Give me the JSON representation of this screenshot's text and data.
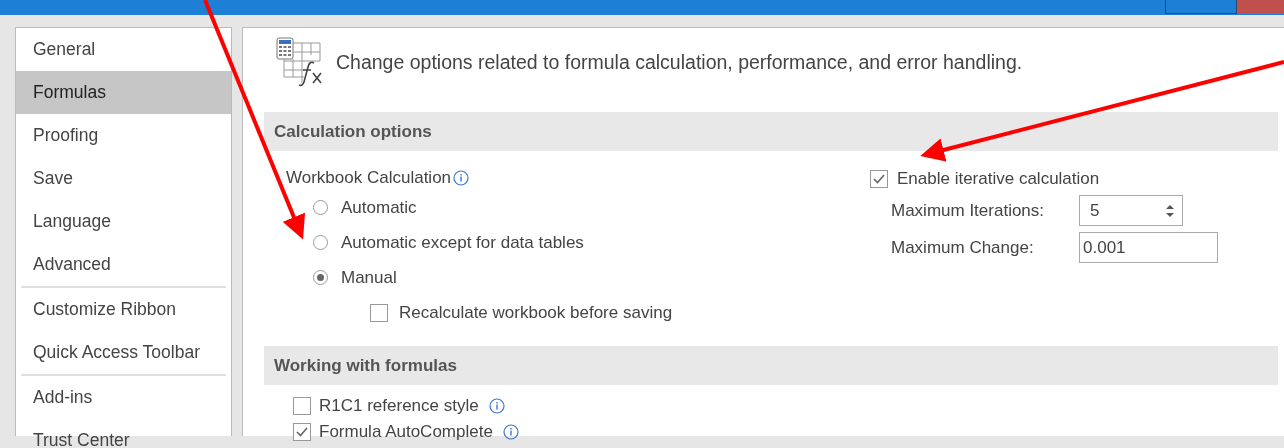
{
  "sidebar": {
    "groups": [
      [
        {
          "label": "General",
          "selected": false
        },
        {
          "label": "Formulas",
          "selected": true
        },
        {
          "label": "Proofing",
          "selected": false
        },
        {
          "label": "Save",
          "selected": false
        },
        {
          "label": "Language",
          "selected": false
        },
        {
          "label": "Advanced",
          "selected": false
        }
      ],
      [
        {
          "label": "Customize Ribbon",
          "selected": false
        },
        {
          "label": "Quick Access Toolbar",
          "selected": false
        }
      ],
      [
        {
          "label": "Add-ins",
          "selected": false
        },
        {
          "label": "Trust Center",
          "selected": false
        }
      ]
    ]
  },
  "header": {
    "text": "Change options related to formula calculation, performance, and error handling."
  },
  "calculation_options": {
    "title": "Calculation options",
    "workbook_calculation": {
      "label": "Workbook Calculation",
      "options": [
        {
          "label": "Automatic",
          "selected": false
        },
        {
          "label": "Automatic except for data tables",
          "selected": false
        },
        {
          "label": "Manual",
          "selected": true
        }
      ],
      "recalculate": {
        "label": "Recalculate workbook before saving",
        "checked": false
      }
    },
    "iterative": {
      "label": "Enable iterative calculation",
      "checked": true,
      "max_iterations": {
        "label": "Maximum Iterations:",
        "value": "5"
      },
      "max_change": {
        "label": "Maximum Change:",
        "value": "0.001"
      }
    }
  },
  "working_with_formulas": {
    "title": "Working with formulas",
    "options": [
      {
        "label": "R1C1 reference style",
        "checked": false
      },
      {
        "label": "Formula AutoComplete",
        "checked": true
      }
    ]
  }
}
